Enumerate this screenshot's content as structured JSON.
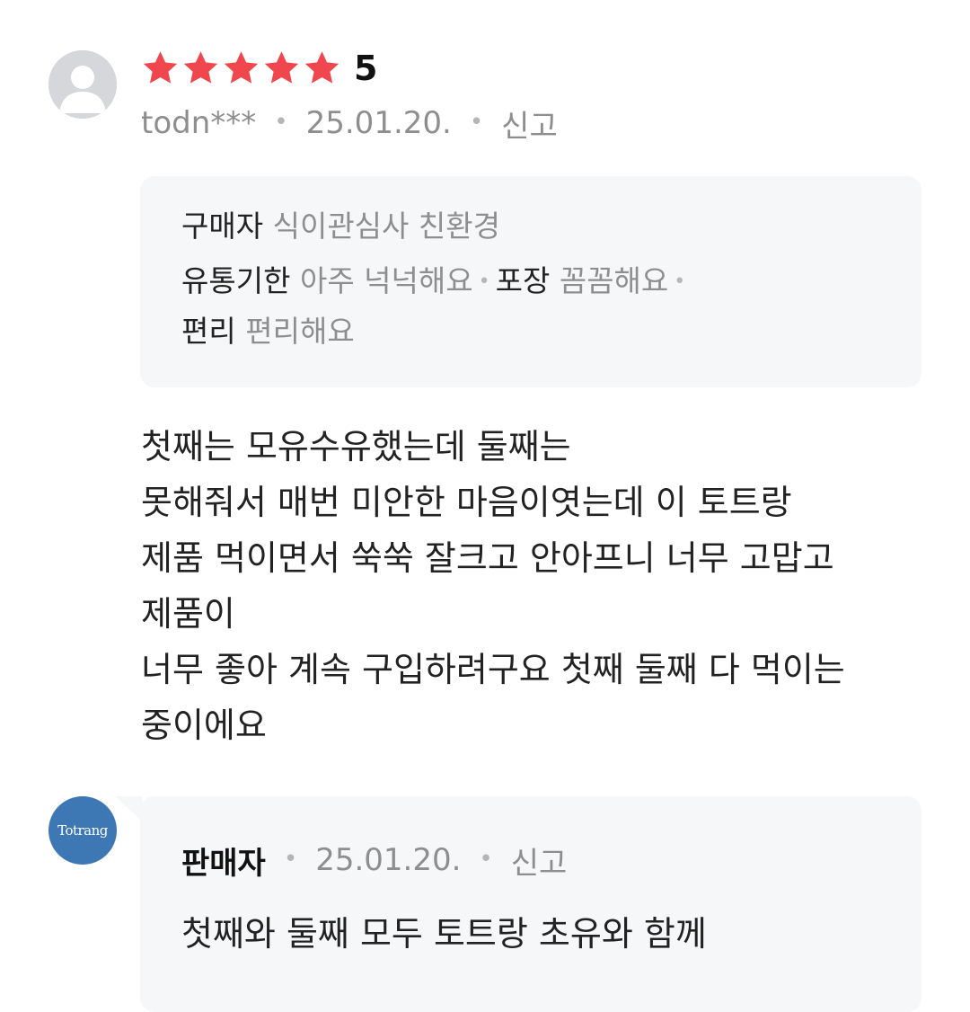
{
  "review": {
    "rating_value": "5",
    "stars_filled": 5,
    "stars_total": 5,
    "star_color": "#f0474f",
    "author": "todn***",
    "date": "25.01.20.",
    "report_label": "신고",
    "survey": {
      "rows": [
        [
          {
            "key": "구매자",
            "value": "식이관심사 친환경"
          }
        ],
        [
          {
            "key": "유통기한",
            "value": "아주 넉넉해요"
          },
          {
            "key": "포장",
            "value": "꼼꼼해요"
          }
        ],
        [
          {
            "key": "편리",
            "value": "편리해요"
          }
        ]
      ]
    },
    "body_lines": [
      "첫째는 모유수유했는데 둘째는",
      "못해줘서 매번 미안한 마음이엿는데 이 토트랑",
      "제품 먹이면서 쑥쑥 잘크고 안아프니 너무 고맙고",
      "제품이",
      "너무 좋아 계속 구입하려구요 첫째 둘째 다 먹이는",
      "중이에요"
    ]
  },
  "seller_reply": {
    "avatar_text": "Totrang",
    "avatar_color": "#3d78b4",
    "author": "판매자",
    "date": "25.01.20.",
    "report_label": "신고",
    "text_line": "첫째와 둘째 모두 토트랑 초유와 함께"
  }
}
